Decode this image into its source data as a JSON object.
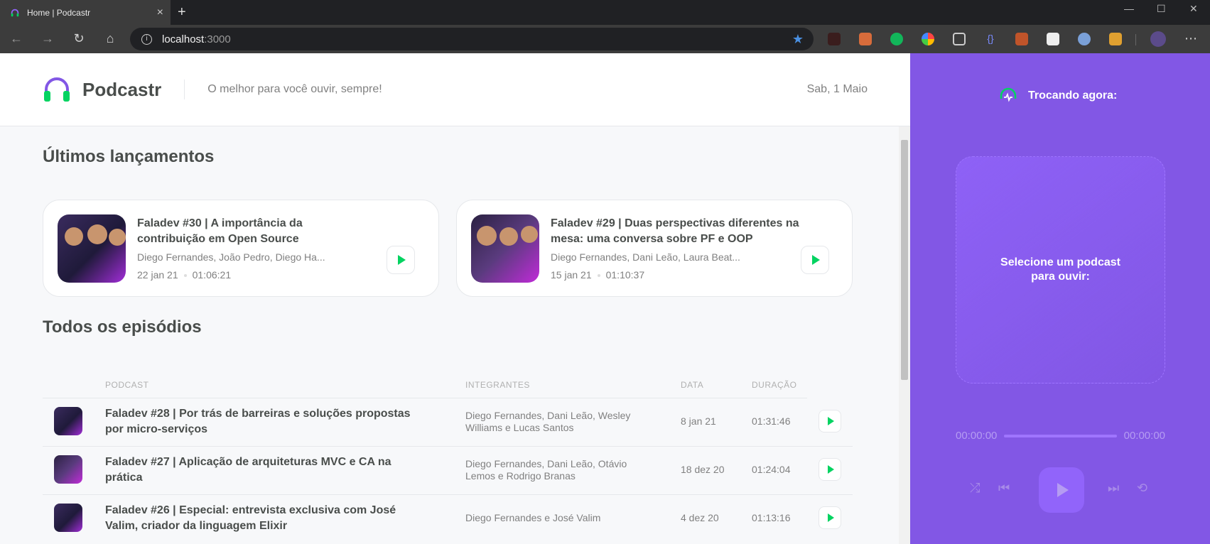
{
  "browser": {
    "tab_title": "Home | Podcastr",
    "new_tab": "+",
    "url_host": "localhost",
    "url_port": ":3000"
  },
  "header": {
    "brand": "Podcastr",
    "tagline": "O melhor para você ouvir, sempre!",
    "date": "Sab, 1 Maio"
  },
  "latest": {
    "heading": "Últimos lançamentos",
    "cards": [
      {
        "title": "Faladev #30 | A importância da contribuição em Open Source",
        "members": "Diego Fernandes, João Pedro, Diego Ha...",
        "date": "22 jan 21",
        "duration": "01:06:21"
      },
      {
        "title": "Faladev #29 | Duas perspectivas diferentes na mesa: uma conversa sobre PF e OOP",
        "members": "Diego Fernandes, Dani Leão, Laura Beat...",
        "date": "15 jan 21",
        "duration": "01:10:37"
      }
    ]
  },
  "all": {
    "heading": "Todos os episódios",
    "columns": [
      "Podcast",
      "Integrantes",
      "Data",
      "Duração"
    ],
    "rows": [
      {
        "title": "Faladev #28 | Por trás de barreiras e soluções propostas por micro-serviços",
        "members": "Diego Fernandes, Dani Leão, Wesley Williams e Lucas Santos",
        "date": "8 jan 21",
        "duration": "01:31:46"
      },
      {
        "title": "Faladev #27 | Aplicação de arquiteturas MVC e CA na prática",
        "members": "Diego Fernandes, Dani Leão, Otávio Lemos e Rodrigo Branas",
        "date": "18 dez 20",
        "duration": "01:24:04"
      },
      {
        "title": "Faladev #26 | Especial: entrevista exclusiva com José Valim, criador da linguagem Elixir",
        "members": "Diego Fernandes e José Valim",
        "date": "4 dez 20",
        "duration": "01:13:16"
      }
    ]
  },
  "player": {
    "now_playing": "Trocando agora:",
    "empty_message": "Selecione um podcast para ouvir:",
    "time_current": "00:00:00",
    "time_total": "00:00:00"
  },
  "colors": {
    "purple": "#8257e5",
    "green": "#04d361",
    "text": "#494d4b"
  }
}
